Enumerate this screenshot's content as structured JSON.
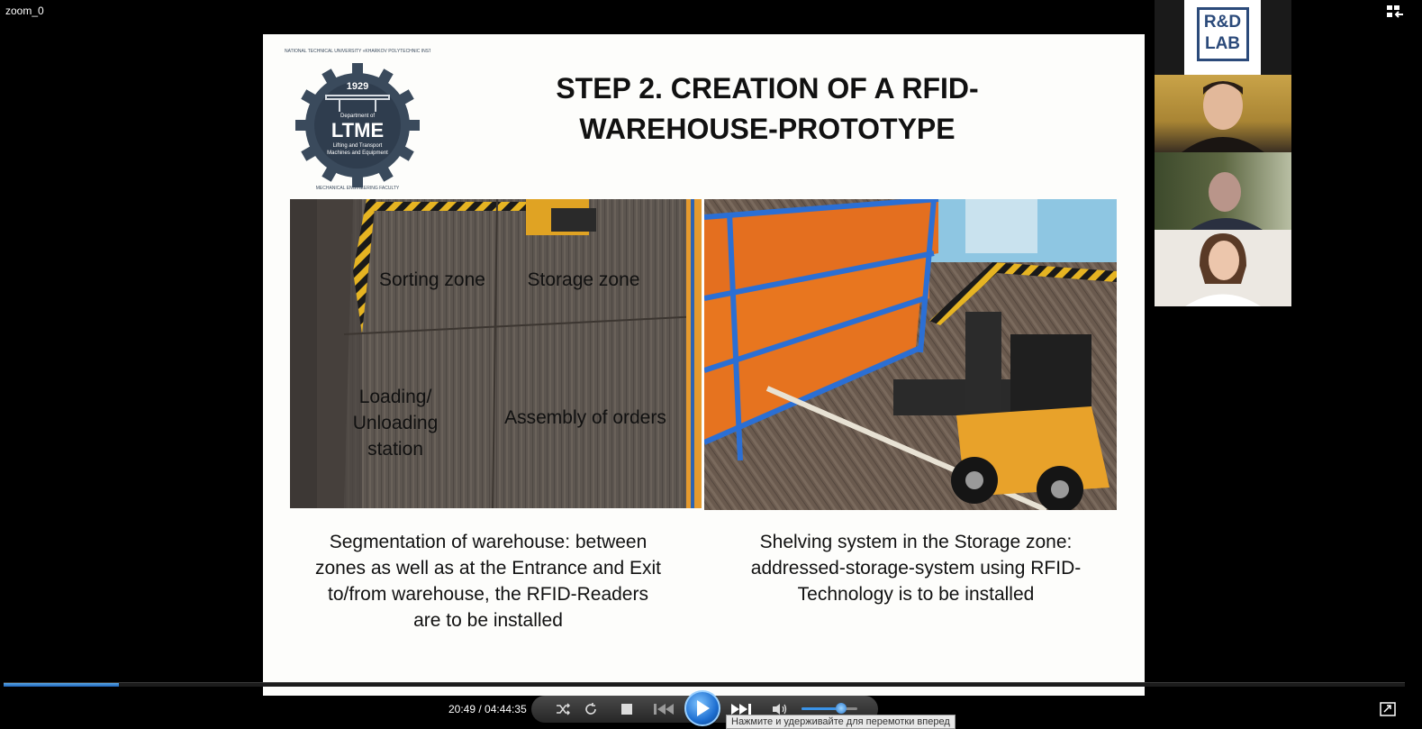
{
  "window": {
    "title": "zoom_0"
  },
  "slide": {
    "title_line1": "STEP 2. CREATION OF A RFID-",
    "title_line2": "WAREHOUSE-PROTOTYPE",
    "logo": {
      "year": "1929",
      "department": "Department of",
      "name": "LTME",
      "subtitle_1": "Lifting and Transport",
      "subtitle_2": "Machines and Equipment",
      "ring_top": "NATIONAL TECHNICAL UNIVERSITY «KHARKOV POLYTECHNIC INSTITUTE»",
      "ring_bottom": "MECHANICAL ENGINEERING FACULTY"
    },
    "left_photo": {
      "zone_sorting": "Sorting zone",
      "zone_storage": "Storage zone",
      "zone_loading_1": "Loading/",
      "zone_loading_2": "Unloading",
      "zone_loading_3": "station",
      "zone_assembly": "Assembly of orders"
    },
    "caption_left_1": "Segmentation of warehouse: between",
    "caption_left_2": "zones as well as at the Entrance and Exit",
    "caption_left_3": "to/from warehouse, the RFID-Readers",
    "caption_left_4": "are to be installed",
    "caption_right_1": "Shelving system in the Storage zone:",
    "caption_right_2": "addressed-storage-system using RFID-",
    "caption_right_3": "Technology is to be installed"
  },
  "participants": {
    "logo_text_top": "R&D",
    "logo_text_bottom": "LAB"
  },
  "player": {
    "time": "20:49 / 04:44:35",
    "progress": 0.082,
    "volume": 0.62,
    "tooltip": "Нажмите и удерживайте для перемотки вперед"
  }
}
